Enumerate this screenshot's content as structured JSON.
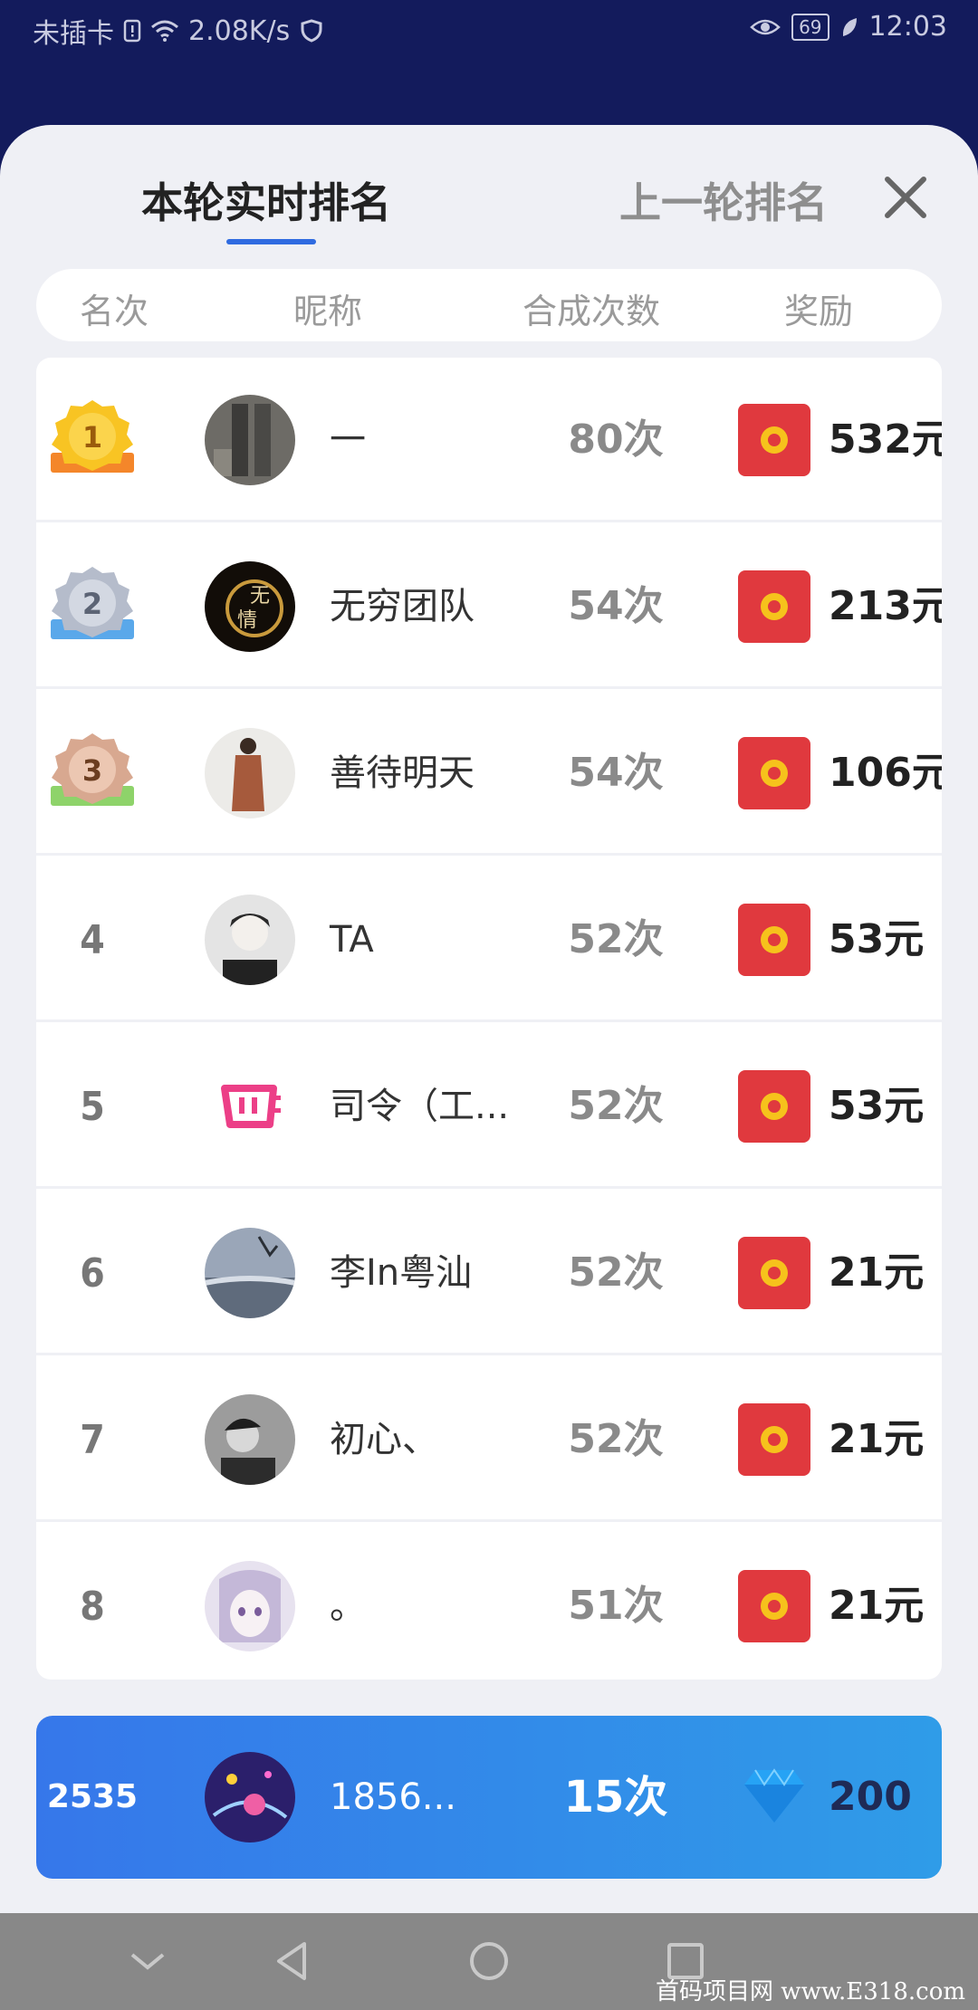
{
  "status_bar": {
    "carrier": "未插卡",
    "speed": "2.08K/s",
    "battery": "69",
    "time": "12:03"
  },
  "tabs": {
    "current": "本轮实时排名",
    "previous": "上一轮排名"
  },
  "columns": {
    "rank": "名次",
    "nickname": "昵称",
    "count": "合成次数",
    "reward": "奖励"
  },
  "rows": [
    {
      "rank": "1",
      "nickname": "一",
      "count": "80次",
      "reward": "532元"
    },
    {
      "rank": "2",
      "nickname": "无穷团队",
      "count": "54次",
      "reward": "213元"
    },
    {
      "rank": "3",
      "nickname": "善待明天",
      "count": "54次",
      "reward": "106元"
    },
    {
      "rank": "4",
      "nickname": "TA",
      "count": "52次",
      "reward": "53元"
    },
    {
      "rank": "5",
      "nickname": "司令（工...",
      "count": "52次",
      "reward": "53元"
    },
    {
      "rank": "6",
      "nickname": "李In粤汕",
      "count": "52次",
      "reward": "21元"
    },
    {
      "rank": "7",
      "nickname": "初心、",
      "count": "52次",
      "reward": "21元"
    },
    {
      "rank": "8",
      "nickname": "。",
      "count": "51次",
      "reward": "21元"
    }
  ],
  "me": {
    "rank": "2535",
    "nickname": "1856...",
    "count": "15次",
    "reward": "200"
  },
  "watermark": "首码项目网 www.E318.com",
  "colors": {
    "header_bg": "#131b5c",
    "accent": "#2f6be0",
    "packet_red": "#e0393e",
    "coin_gold": "#f6c21c",
    "me_gradient_start": "#3677ea",
    "me_gradient_end": "#2f9ce8"
  },
  "icons": {
    "medal_1": "gold-medal-icon",
    "medal_2": "silver-medal-icon",
    "medal_3": "bronze-medal-icon",
    "reward": "red-packet-icon",
    "me_reward": "diamond-icon"
  }
}
